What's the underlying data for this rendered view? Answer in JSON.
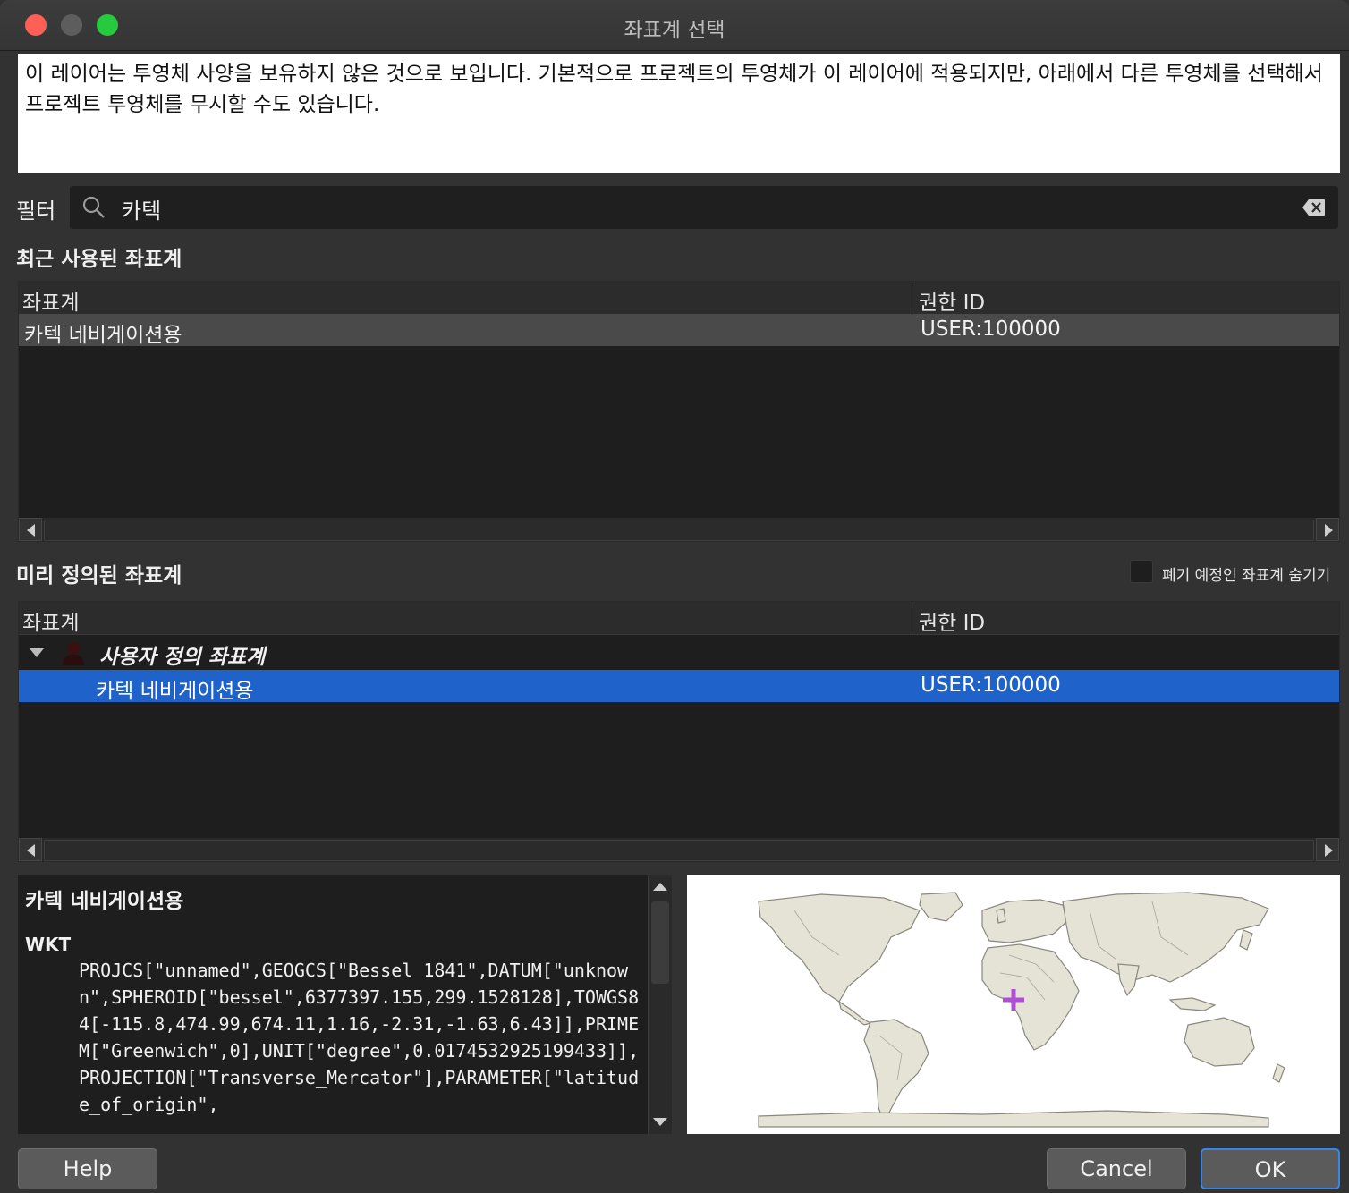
{
  "window": {
    "title": "좌표계 선택"
  },
  "message": "이 레이어는 투영체 사양을 보유하지 않은 것으로 보입니다. 기본적으로 프로젝트의 투영체가 이 레이어에 적용되지만, 아래에서 다른 투영체를 선택해서 프로젝트 투영체를 무시할 수도 있습니다.",
  "filter": {
    "label": "필터",
    "value": "카텍"
  },
  "recent": {
    "title": "최근 사용된 좌표계",
    "columns": [
      "좌표계",
      "권한 ID"
    ],
    "rows": [
      {
        "name": "카텍 네비게이션용",
        "auth_id": "USER:100000"
      }
    ]
  },
  "predefined": {
    "title": "미리 정의된 좌표계",
    "hide_deprecated_label": "폐기 예정인 좌표계 숨기기",
    "hide_deprecated_checked": false,
    "columns": [
      "좌표계",
      "권한 ID"
    ],
    "group": "사용자 정의 좌표계",
    "rows": [
      {
        "name": "카텍 네비게이션용",
        "auth_id": "USER:100000",
        "selected": true
      }
    ]
  },
  "details": {
    "title": "카텍 네비게이션용",
    "wkt_label": "WKT",
    "wkt": "PROJCS[\"unnamed\",GEOGCS[\"Bessel 1841\",DATUM[\"unknown\",SPHEROID[\"bessel\",6377397.155,299.1528128],TOWGS84[-115.8,474.99,674.11,1.16,-2.31,-1.63,6.43]],PRIMEM[\"Greenwich\",0],UNIT[\"degree\",0.0174532925199433]],PROJECTION[\"Transverse_Mercator\"],PARAMETER[\"latitude_of_origin\","
  },
  "buttons": {
    "help": "Help",
    "cancel": "Cancel",
    "ok": "OK"
  },
  "colors": {
    "selection": "#1f62c9",
    "marker": "#b04fd6",
    "land": "#e5e2d6"
  }
}
